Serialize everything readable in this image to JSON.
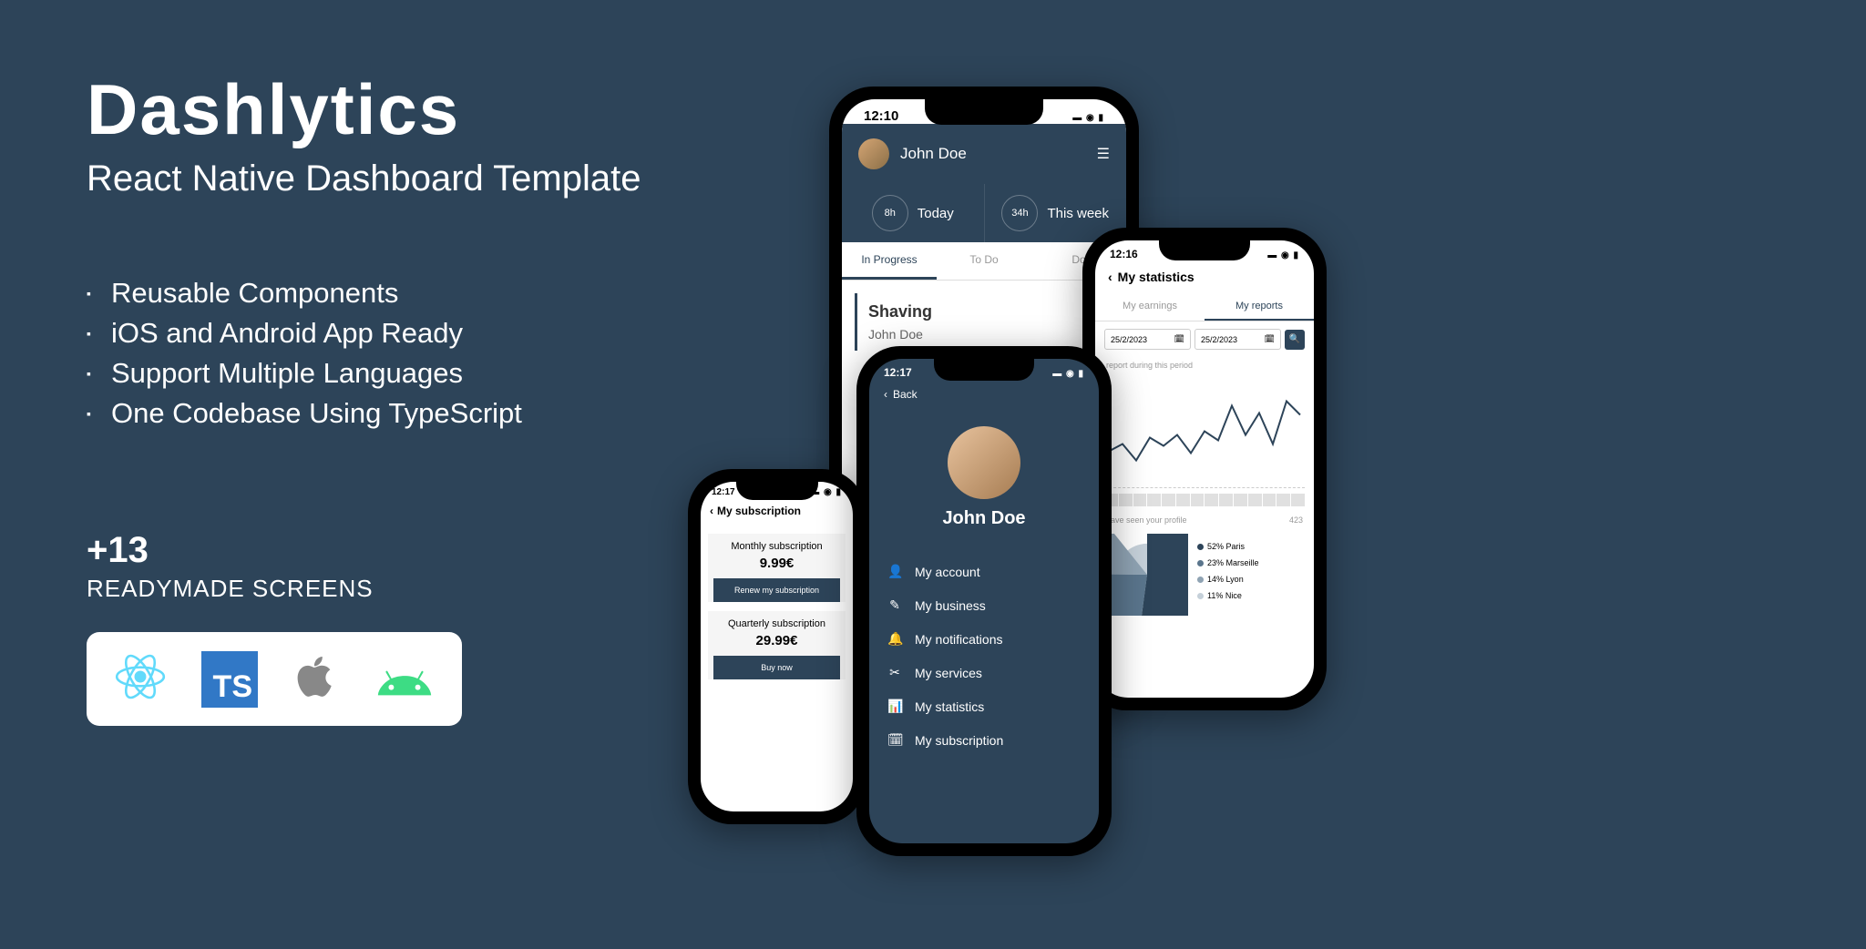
{
  "hero": {
    "title": "Dashlytics",
    "subtitle": "React Native Dashboard Template",
    "features": [
      "Reusable Components",
      "iOS and Android App Ready",
      "Support Multiple Languages",
      "One Codebase Using  TypeScript"
    ],
    "screens_count": "+13",
    "screens_label": "READYMADE SCREENS"
  },
  "tech": {
    "react": "React",
    "ts": "TS",
    "apple": "Apple",
    "android": "Android"
  },
  "phone1": {
    "time": "12:10",
    "user": "John Doe",
    "stats": [
      {
        "value": "8h",
        "label": "Today"
      },
      {
        "value": "34h",
        "label": "This week"
      }
    ],
    "tabs": [
      "In Progress",
      "To Do",
      "Do"
    ],
    "card": {
      "title": "Shaving",
      "sub": "John Doe"
    }
  },
  "phone2": {
    "time": "12:16",
    "title": "My statistics",
    "tabs": [
      "My earnings",
      "My reports"
    ],
    "date_from": "25/2/2023",
    "date_to": "25/2/2023",
    "chart_label": "report during this period",
    "profile_label": "have seen your profile",
    "profile_count": "423",
    "pie_legend": [
      {
        "pct": "52%",
        "city": "Paris",
        "color": "#2d4459"
      },
      {
        "pct": "23%",
        "city": "Marseille",
        "color": "#5a758c"
      },
      {
        "pct": "14%",
        "city": "Lyon",
        "color": "#8fa3b3"
      },
      {
        "pct": "11%",
        "city": "Nice",
        "color": "#c5d0d9"
      }
    ]
  },
  "phone3": {
    "time": "12:17",
    "back": "Back",
    "name": "John Doe",
    "menu": [
      {
        "icon": "👤",
        "label": "My account"
      },
      {
        "icon": "✎",
        "label": "My business"
      },
      {
        "icon": "🔔",
        "label": "My notifications"
      },
      {
        "icon": "✂",
        "label": "My services"
      },
      {
        "icon": "📊",
        "label": "My statistics"
      },
      {
        "icon": "🗓",
        "label": "My subscription"
      }
    ]
  },
  "phone4": {
    "time": "12:17",
    "title": "My subscription",
    "plans": [
      {
        "name": "Monthly subscription",
        "price": "9.99€",
        "btn": "Renew my subscription"
      },
      {
        "name": "Quarterly subscription",
        "price": "29.99€",
        "btn": "Buy now"
      }
    ]
  },
  "chart_data": {
    "line": {
      "type": "line",
      "title": "report during this period",
      "x": [
        1,
        2,
        3,
        4,
        5,
        6,
        7,
        8,
        9,
        10,
        11,
        12,
        13,
        14
      ],
      "values": [
        18,
        25,
        10,
        30,
        22,
        35,
        15,
        38,
        28,
        55,
        30,
        48,
        25,
        58
      ]
    },
    "pie": {
      "type": "pie",
      "title": "have seen your profile",
      "total": 423,
      "categories": [
        "Paris",
        "Marseille",
        "Lyon",
        "Nice"
      ],
      "values": [
        52,
        23,
        14,
        11
      ]
    }
  }
}
